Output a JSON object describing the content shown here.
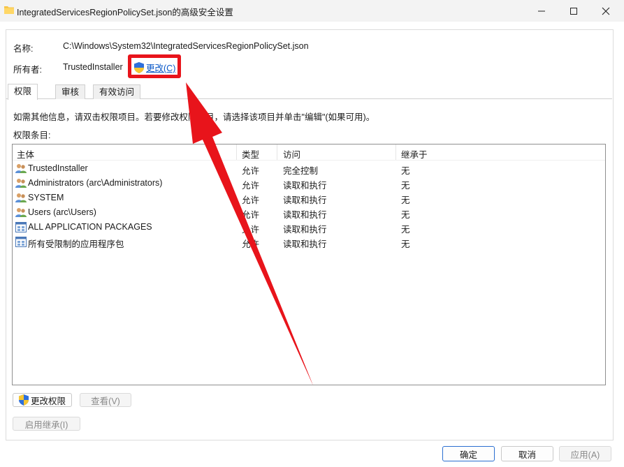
{
  "window": {
    "title": "IntegratedServicesRegionPolicySet.json的高级安全设置",
    "controls": {
      "minimize": "—",
      "maximize": "☐",
      "close": "✕"
    }
  },
  "info": {
    "name_label": "名称:",
    "name_value": "C:\\Windows\\System32\\IntegratedServicesRegionPolicySet.json",
    "owner_label": "所有者:",
    "owner_value": "TrustedInstaller",
    "change_link": "更改(C)"
  },
  "tabs": [
    {
      "label": "权限",
      "active": true
    },
    {
      "label": "审核",
      "active": false
    },
    {
      "label": "有效访问",
      "active": false
    }
  ],
  "instructions": "如需其他信息，请双击权限项目。若要修改权限项目，请选择该项目并单击\"编辑\"(如果可用)。",
  "entries_label": "权限条目:",
  "table": {
    "columns": [
      "主体",
      "类型",
      "访问",
      "继承于"
    ],
    "rows": [
      {
        "principal": "TrustedInstaller",
        "type": "允许",
        "access": "完全控制",
        "inherited": "无",
        "icon": "users-icon"
      },
      {
        "principal": "Administrators (arc\\Administrators)",
        "type": "允许",
        "access": "读取和执行",
        "inherited": "无",
        "icon": "users-icon"
      },
      {
        "principal": "SYSTEM",
        "type": "允许",
        "access": "读取和执行",
        "inherited": "无",
        "icon": "users-icon"
      },
      {
        "principal": "Users (arc\\Users)",
        "type": "允许",
        "access": "读取和执行",
        "inherited": "无",
        "icon": "users-icon"
      },
      {
        "principal": "ALL APPLICATION PACKAGES",
        "type": "允许",
        "access": "读取和执行",
        "inherited": "无",
        "icon": "app-package-icon"
      },
      {
        "principal": "所有受限制的应用程序包",
        "type": "允许",
        "access": "读取和执行",
        "inherited": "无",
        "icon": "app-package-icon"
      }
    ]
  },
  "buttons": {
    "change_permissions": "更改权限",
    "view": "查看(V)",
    "enable_inheritance": "启用继承(I)",
    "ok": "确定",
    "cancel": "取消",
    "apply": "应用(A)"
  },
  "colors": {
    "highlight": "#e8141b",
    "link": "#0a58c8",
    "accent": "#2b6fd1"
  }
}
